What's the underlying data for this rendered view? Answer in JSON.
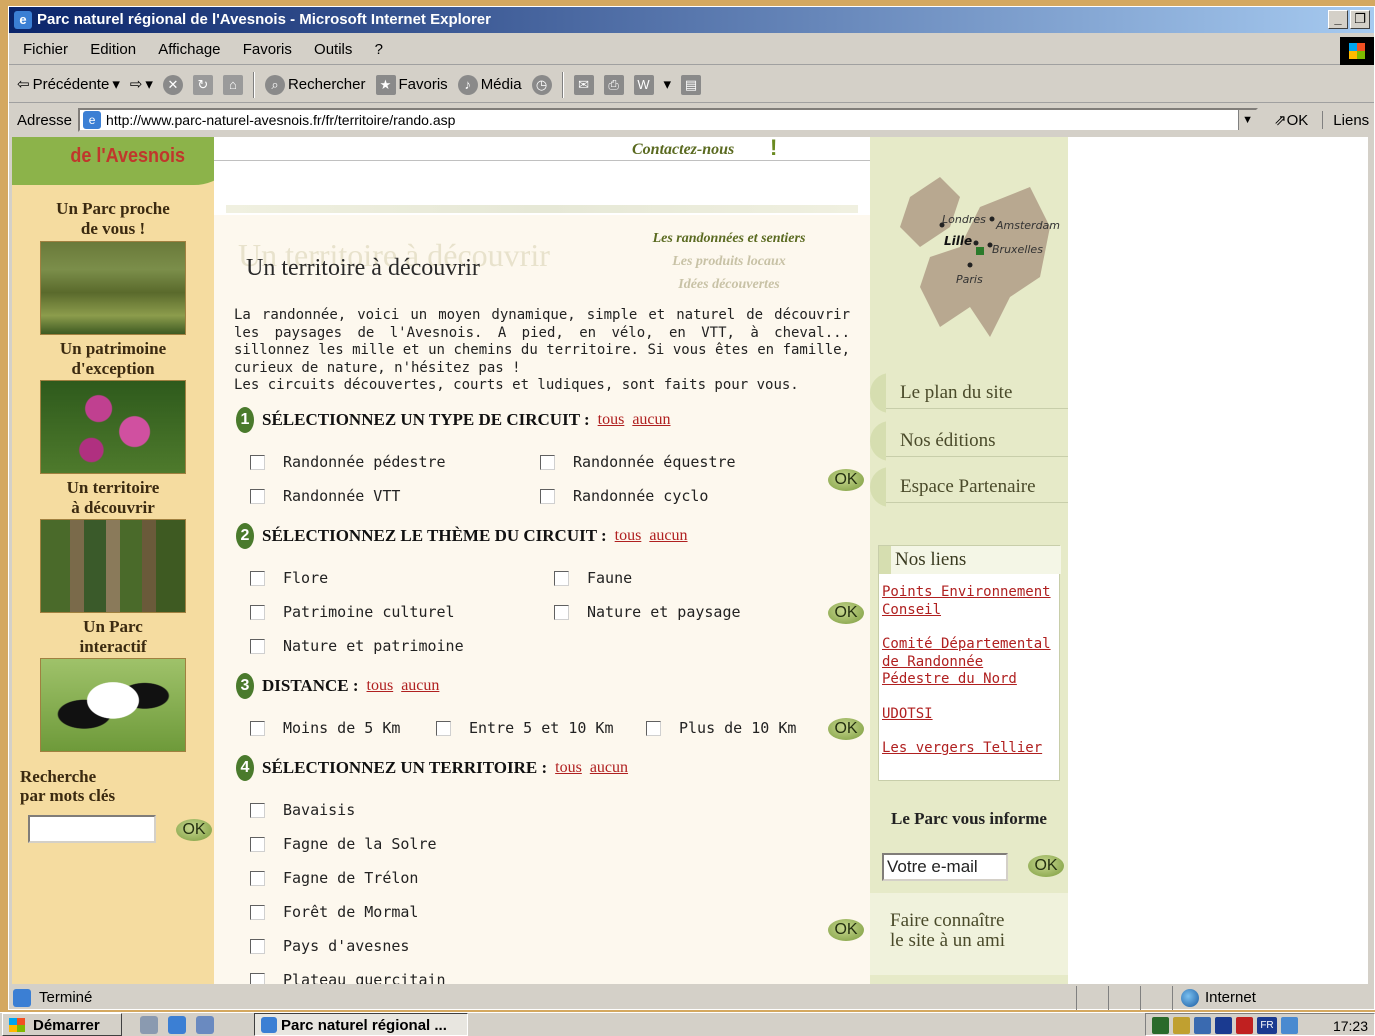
{
  "window": {
    "title": "Parc naturel régional de l'Avesnois - Microsoft Internet Explorer",
    "buttons": [
      "_",
      "❐"
    ]
  },
  "menubar": [
    "Fichier",
    "Edition",
    "Affichage",
    "Favoris",
    "Outils",
    "?"
  ],
  "toolbar": {
    "back": "Précédente",
    "search": "Rechercher",
    "favorites": "Favoris",
    "media": "Média"
  },
  "address": {
    "label": "Adresse",
    "url": "http://www.parc-naturel-avesnois.fr/fr/territoire/rando.asp",
    "go": "OK",
    "links": "Liens"
  },
  "left": {
    "logo": "de l'Avesnois",
    "sections": [
      {
        "title_line1": "Un Parc proche",
        "title_line2": "de vous !"
      },
      {
        "title_line1": "Un patrimoine",
        "title_line2": "d'exception"
      },
      {
        "title_line1": "Un territoire",
        "title_line2": "à découvrir"
      },
      {
        "title_line1": "Un Parc",
        "title_line2": "interactif"
      }
    ],
    "search_line1": "Recherche",
    "search_line2": "par mots clés",
    "search_ok": "OK"
  },
  "main": {
    "contact": "Contactez-nous",
    "ghost_title": "Un territoire à découvrir",
    "title": "Un territoire à découvrir",
    "sublinks": [
      "Les randonnées et sentiers",
      "Les produits locaux",
      "Idées découvertes"
    ],
    "intro_1": "La randonnée, voici un moyen dynamique, simple et naturel de découvrir les paysages de l'Avesnois. A pied, en vélo, en VTT, à cheval... sillonnez les mille et un chemins du territoire. Si vous êtes en famille, curieux de nature, n'hésitez pas !",
    "intro_2": "Les circuits découvertes, courts et ludiques, sont faits pour vous.",
    "all": "tous",
    "none": "aucun",
    "ok": "OK",
    "sections": [
      {
        "num": "1",
        "title": "SÉLECTIONNEZ UN TYPE DE CIRCUIT :",
        "options": [
          "Randonnée pédestre",
          "Randonnée équestre",
          "Randonnée VTT",
          "Randonnée cyclo"
        ]
      },
      {
        "num": "2",
        "title": "SÉLECTIONNEZ LE THÈME DU CIRCUIT :",
        "options": [
          "Flore",
          "Faune",
          "Patrimoine culturel",
          "Nature et paysage",
          "Nature et patrimoine"
        ]
      },
      {
        "num": "3",
        "title": "DISTANCE :",
        "options": [
          "Moins de 5 Km",
          "Entre 5 et 10 Km",
          "Plus de 10 Km"
        ]
      },
      {
        "num": "4",
        "title": "SÉLECTIONNEZ UN TERRITOIRE :",
        "options": [
          "Bavaisis",
          "Fagne de la Solre",
          "Fagne de Trélon",
          "Forêt de Mormal",
          "Pays d'avesnes",
          "Plateau quercitain"
        ]
      }
    ]
  },
  "right": {
    "map_labels": [
      "Londres",
      "Amsterdam",
      "Lille",
      "Bruxelles",
      "Paris"
    ],
    "links": [
      "Le plan du site",
      "Nos éditions",
      "Espace Partenaire"
    ],
    "nos_liens": "Nos liens",
    "external_links": [
      "Points Environnement Conseil",
      "Comité Départemental de Randonnée Pédestre du Nord",
      "UDOTSI",
      "Les vergers Tellier"
    ],
    "informe": "Le Parc vous informe",
    "email_value": "Votre e-mail",
    "email_ok": "OK",
    "friend_line1": "Faire connaître",
    "friend_line2": "le site à un ami"
  },
  "status": {
    "text": "Terminé",
    "zone": "Internet"
  },
  "taskbar": {
    "start": "Démarrer",
    "task": "Parc naturel régional ...",
    "tray_lang": "FR",
    "clock": "17:23"
  }
}
